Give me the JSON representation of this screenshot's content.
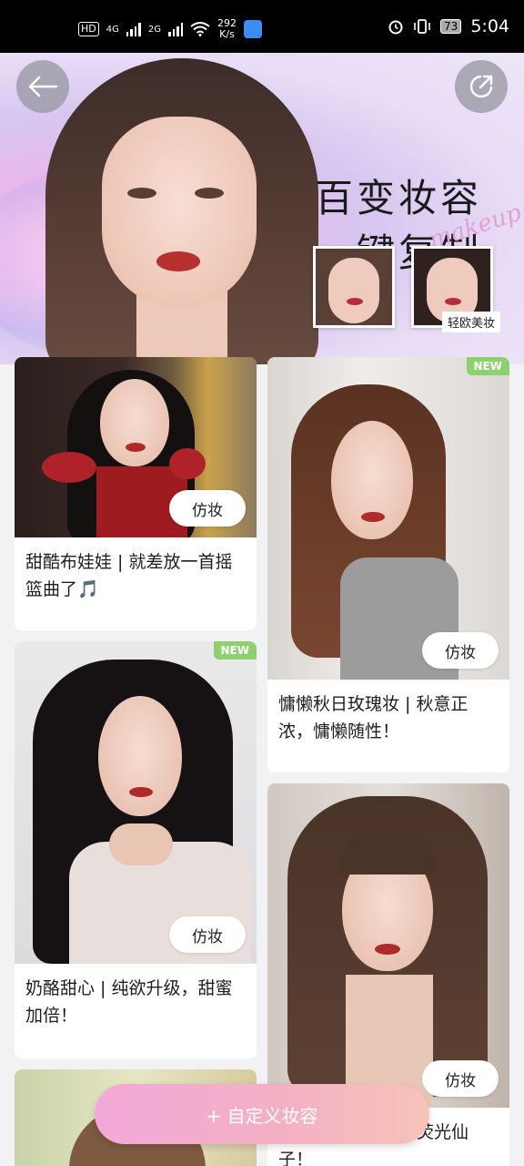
{
  "status_bar": {
    "hd": "HD",
    "net1": "4G",
    "net2": "2G",
    "speed_value": "292",
    "speed_unit": "K/s",
    "battery": "73",
    "time": "5:04"
  },
  "hero": {
    "title_line1": "百变妆容",
    "title_line2": "一键复制",
    "script_text": "makeup",
    "tag": "轻欧美妆"
  },
  "cards": [
    {
      "caption": "甜酷布娃娃 | 就差放一首摇篮曲了🎵",
      "button": "仿妆",
      "new": ""
    },
    {
      "caption": "慵懒秋日玫瑰妆 | 秋意正浓，慵懒随性！",
      "button": "仿妆",
      "new": "NEW"
    },
    {
      "caption": "奶酪甜心 | 纯欲升级，甜蜜加倍！",
      "button": "仿妆",
      "new": "NEW"
    },
    {
      "caption": "夏日静谧森林中的荧光仙子！",
      "button": "仿妆",
      "new": ""
    }
  ],
  "fab_label": "+ 自定义妆容",
  "colors": {
    "new_badge": "#8dd16e",
    "fab_start": "#f2a9d8",
    "fab_end": "#f7c3b8",
    "hero_bg": "#e8dcf6"
  },
  "icons": [
    "back-arrow-icon",
    "share-icon",
    "alarm-icon",
    "vibrate-icon",
    "wifi-icon",
    "battery-icon"
  ]
}
